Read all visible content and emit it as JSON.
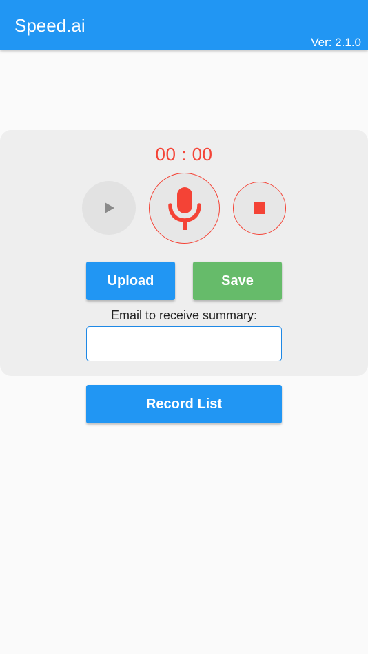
{
  "app_bar": {
    "title": "Speed.ai",
    "version": "Ver: 2.1.0"
  },
  "recorder": {
    "timer": "00 : 00",
    "play_icon": "play-icon",
    "mic_icon": "microphone-icon",
    "stop_icon": "stop-icon",
    "upload_label": "Upload",
    "save_label": "Save",
    "email_label": "Email to receive summary:",
    "email_value": "",
    "email_placeholder": ""
  },
  "record_list_label": "Record List",
  "colors": {
    "primary": "#2196f3",
    "accent_red": "#f44336",
    "save_green": "#66bb6a",
    "card_background": "#eeeeee",
    "page_background": "#fafafa"
  }
}
